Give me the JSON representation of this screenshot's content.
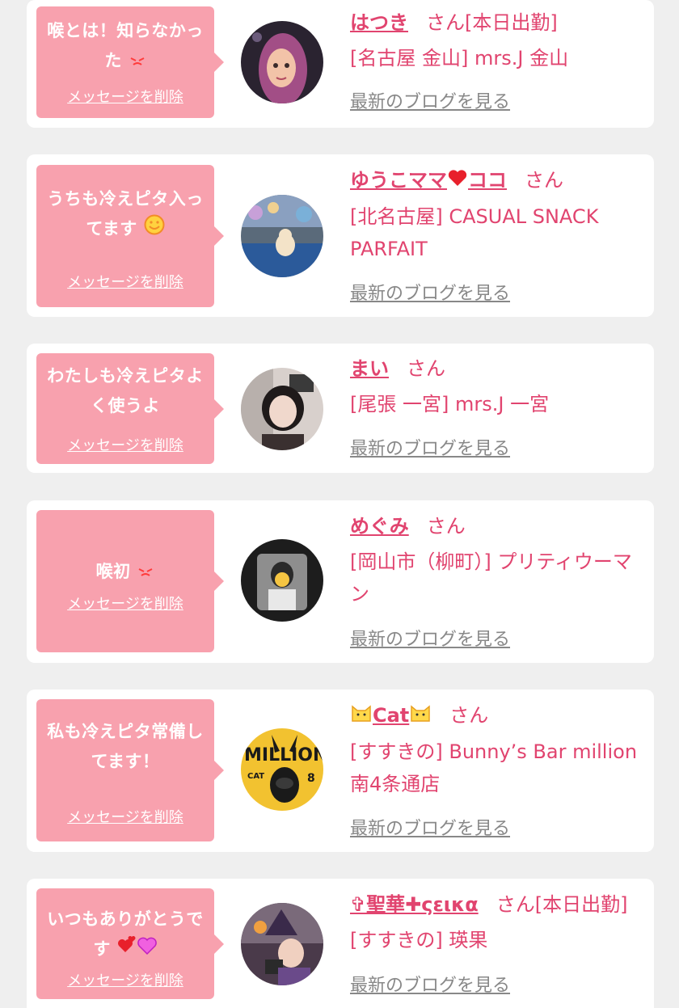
{
  "common": {
    "delete_label": "メッセージを削除",
    "blog_label": "最新のブログを見る",
    "honorific": "さん"
  },
  "colors": {
    "page_bg": "#efefef",
    "bubble_bg": "#f8a1ae",
    "name": "#e1446f",
    "blog_link": "#888888"
  },
  "entries": [
    {
      "message": "喉とは！知らなかった",
      "message_emoji": "angry-face-icon",
      "name": "はつき",
      "status": "[本日出勤]",
      "shop": "[名古屋 金山] mrs.J 金山"
    },
    {
      "message": "うちも冷えピタ入ってます",
      "message_emoji": "smiley-face-icon",
      "name": "ゆうこママ",
      "name_emoji": "heart-icon",
      "name_suffix": "ココ",
      "status": "",
      "shop": "[北名古屋] CASUAL SNACK PARFAIT"
    },
    {
      "message": "わたしも冷えピタよく使うよ",
      "name": "まい",
      "status": "",
      "shop": "[尾張 一宮] mrs.J 一宮"
    },
    {
      "message": "喉初",
      "message_emoji": "angry-face-icon",
      "name": "めぐみ",
      "status": "",
      "shop": "[岡山市（柳町）] プリティウーマン"
    },
    {
      "message": "私も冷えピタ常備してます！",
      "name": "Cat",
      "name_emoji": "cat-face-icon",
      "status": "",
      "shop": "[すすきの] Bunny’s Bar million 南4条通店"
    },
    {
      "message": "いつもありがとうです",
      "message_emoji": "hearts-icon",
      "name": "✞聖華✚ςεικα",
      "status": "[本日出勤]",
      "shop": "[すすきの] 瑛果"
    }
  ]
}
